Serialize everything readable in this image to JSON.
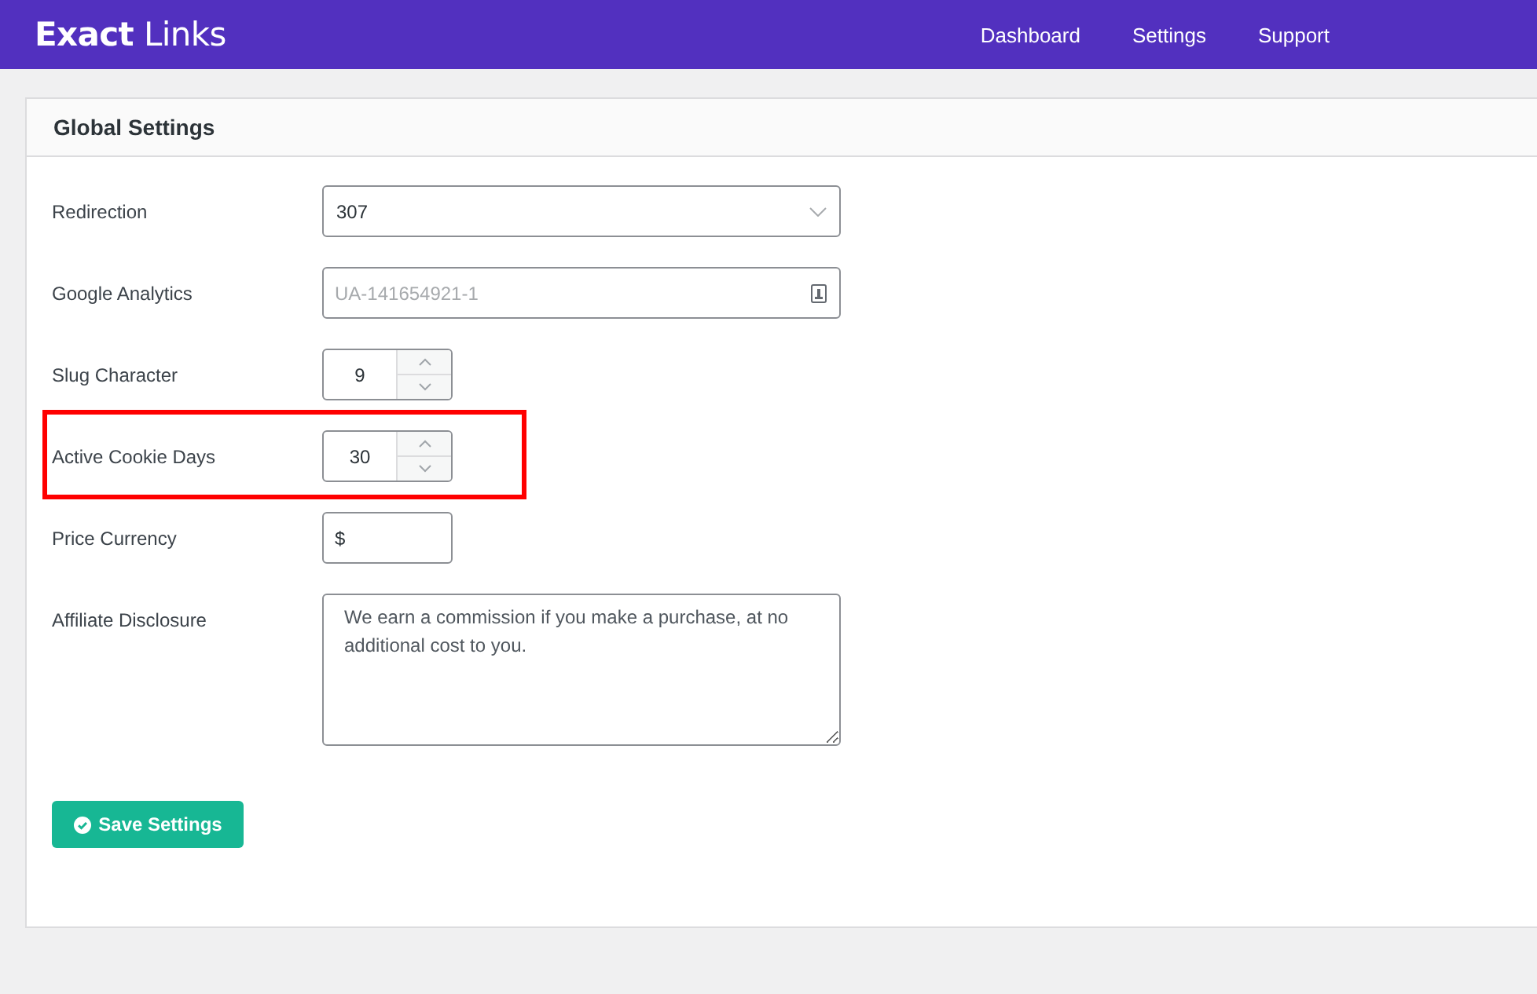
{
  "brand": "**Exact** Links",
  "nav": [
    {
      "label": "Dashboard"
    },
    {
      "label": "Settings"
    },
    {
      "label": "Support"
    }
  ],
  "panel_title": "Global Settings",
  "fields": [
    {
      "label": "Redirection",
      "kind": "select",
      "value": "307",
      "highlighted": false
    },
    {
      "label": "Google Analytics",
      "kind": "text",
      "placeholder": "UA-141654921-1",
      "highlighted": false
    },
    {
      "label": "Slug Character",
      "kind": "number",
      "value": "9",
      "highlighted": false
    },
    {
      "label": "Active Cookie Days",
      "kind": "number",
      "value": "30",
      "highlighted": true
    },
    {
      "label": "Price Currency",
      "kind": "short",
      "value": "$",
      "highlighted": false
    },
    {
      "label": "Affiliate Disclosure",
      "kind": "textarea",
      "value": "We earn a commission if you make a purchase, at no additional cost to you.",
      "highlighted": false
    }
  ],
  "save_button": "Save Settings"
}
